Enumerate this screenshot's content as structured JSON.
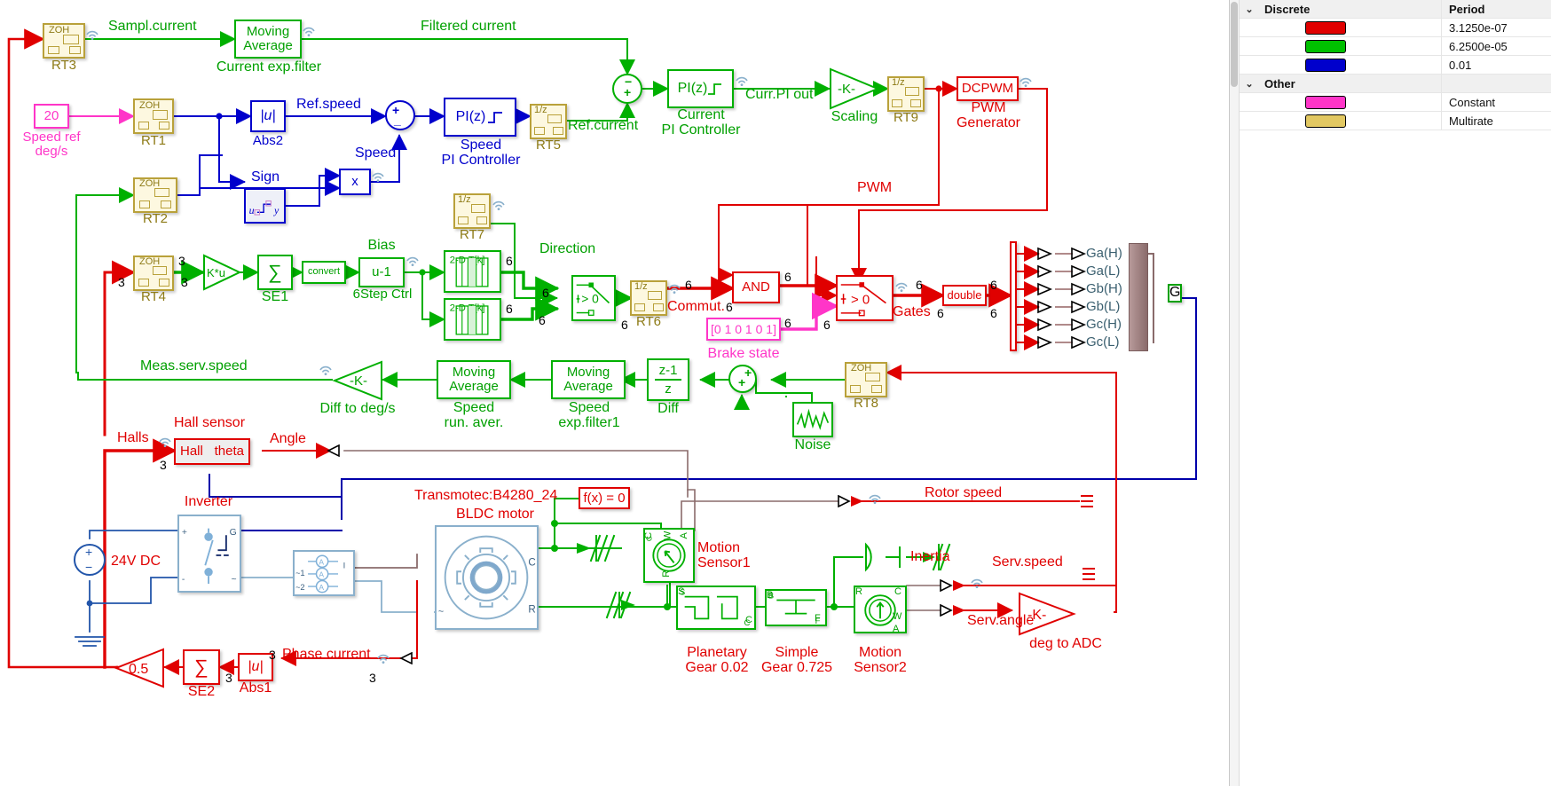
{
  "panel": {
    "groups": [
      {
        "chevron": "⌄",
        "name": "Discrete",
        "value_header": "Period",
        "rows": [
          {
            "color": "#e00000",
            "value": "3.1250e-07"
          },
          {
            "color": "#00c000",
            "value": "6.2500e-05"
          },
          {
            "color": "#0000cc",
            "value": "0.01"
          }
        ]
      },
      {
        "chevron": "⌄",
        "name": "Other",
        "value_header": "",
        "rows": [
          {
            "color": "#ff35c8",
            "value": "Constant"
          },
          {
            "color": "#e2c862",
            "value": "Multirate"
          }
        ]
      }
    ]
  },
  "blocks": {
    "rt3": "RT3",
    "rt3_icon": "ZOH",
    "current_filter": "Moving\nAverage",
    "current_filter_name": "Current exp.filter",
    "speed_ref_value": "20",
    "speed_ref_name": "Speed ref\ndeg/s",
    "rt1": "RT1",
    "rt1_icon": "ZOH",
    "abs2_icon": "|u|",
    "abs2_name": "Abs2",
    "sign_name": "Sign",
    "mult_icon": "x",
    "speed_pi_icon": "PI(z)",
    "speed_pi_name": "Speed\nPI Controller",
    "rt5": "RT5",
    "rt5_icon": "1/z",
    "current_pi_icon": "PI(z)",
    "current_pi_name": "Current\nPI Controller",
    "scaling_icon": "-K-",
    "scaling_name": "Scaling",
    "rt9": "RT9",
    "rt9_icon": "1/z",
    "dcpwm_icon": "DCPWM",
    "dcpwm_name": "PWM\nGenerator",
    "rt2": "RT2",
    "rt2_icon": "ZOH",
    "rt7": "RT7",
    "rt7_icon": "1/z",
    "rt4": "RT4",
    "rt4_icon": "ZOH",
    "gain_ku": "K*u",
    "se1_name": "SE1",
    "se1_icon": "∑",
    "convert_icon": "convert",
    "bias_icon": "u-1",
    "bias_title": "Bias",
    "bias_name": "6Step Ctrl",
    "lut1_icon": "2-D T[k]",
    "lut2_icon": "2-D T[k]",
    "switch1_icon": "> 0",
    "rt6": "RT6",
    "rt6_icon": "1/z",
    "and_icon": "AND",
    "brake_icon": "[0 1 0 1 0 1]",
    "brake_name": "Brake state",
    "switch2_icon": "> 0",
    "double_icon": "double",
    "diff_to_deg_icon": "-K-",
    "diff_to_deg_name": "Diff to deg/s",
    "speed_run_aver": "Moving\nAverage",
    "speed_run_aver_name": "Speed\nrun. aver.",
    "speed_exp_filter1": "Moving\nAverage",
    "speed_exp_filter1_name": "Speed\nexp.filter1",
    "diff_icon_num": "z-1",
    "diff_icon_den": "z",
    "diff_name": "Diff",
    "noise_name": "Noise",
    "rt8": "RT8",
    "rt8_icon": "ZOH",
    "hall_title": "Hall sensor",
    "hall_in": "Hall",
    "hall_out": "theta",
    "inverter_name": "Inverter",
    "dc_source_name": "24V DC",
    "bldc_title": "Transmotec:B4280_24",
    "bldc_name": "BLDC motor",
    "fx_icon": "f(x) = 0",
    "motion_sensor1_name": "Motion\nSensor1",
    "inertia_name": "Inertia",
    "planetary_name": "Planetary\nGear 0.02",
    "simple_gear_name": "Simple\nGear 0.725",
    "motion_sensor2_name": "Motion\nSensor2",
    "deg_to_adc_icon": "-K-",
    "deg_to_adc_name": "deg to ADC",
    "se2_icon": "∑",
    "se2_name": "SE2",
    "abs1_icon": "|u|",
    "abs1_name": "Abs1",
    "gain_half_icon": "0.5"
  },
  "signals": {
    "sampl_current": "Sampl.current",
    "filtered_current": "Filtered current",
    "ref_speed": "Ref.speed",
    "speed": "Speed",
    "ref_current": "Ref.current",
    "curr_pi_out": "Curr.PI out",
    "pwm": "PWM",
    "direction": "Direction",
    "commut": "Commut.",
    "gates": "Gates",
    "meas_serv_speed": "Meas.serv.speed",
    "halls": "Halls",
    "angle": "Angle",
    "rotor_speed": "Rotor speed",
    "serv_speed": "Serv.speed",
    "serv_angle": "Serv.angle",
    "phase_current": "Phase current",
    "bus_g": "G"
  },
  "widths": {
    "w3": "3",
    "w6": "6"
  },
  "ports": {
    "gates": [
      "Ga(H)",
      "Ga(L)",
      "Gb(H)",
      "Gb(L)",
      "Gc(H)",
      "Gc(L)"
    ],
    "motor_c": "C",
    "motor_r": "R",
    "ms1_c": "C",
    "ms1_w": "W",
    "ms1_a": "A",
    "ms1_r": "R",
    "pg_s": "S",
    "pg_c": "C",
    "sg_b": "B",
    "sg_f": "F",
    "ms2_r": "R",
    "ms2_c": "C",
    "ms2_w": "W",
    "ms2_a": "A",
    "inv_plus": "+",
    "inv_minus": "-",
    "meas_1": "1",
    "meas_2": "2",
    "meas_i": "I"
  }
}
